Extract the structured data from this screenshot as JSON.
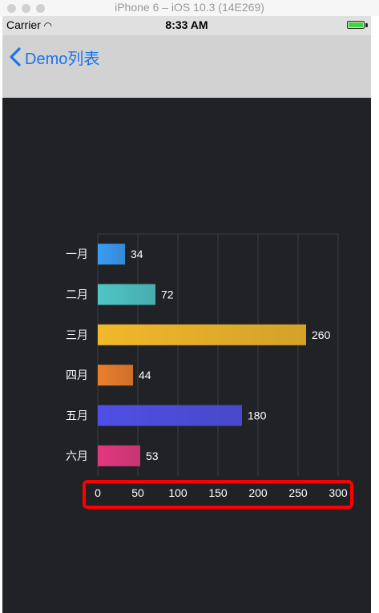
{
  "window": {
    "title": "iPhone 6 – iOS 10.3 (14E269)"
  },
  "status_bar": {
    "carrier": "Carrier",
    "time": "8:33 AM",
    "wifi_icon": "wifi-icon",
    "battery_icon": "battery-icon"
  },
  "nav_bar": {
    "back_label": "Demo列表",
    "back_icon": "chevron-left-icon"
  },
  "colors": {
    "screen_bg": "#202225",
    "nav_tint": "#1a74f0",
    "axis_text": "#ffffff",
    "grid": "#3a3d42",
    "highlight": "#ff0000"
  },
  "chart_data": {
    "type": "bar",
    "orientation": "horizontal",
    "categories": [
      "一月",
      "二月",
      "三月",
      "四月",
      "五月",
      "六月"
    ],
    "values": [
      34,
      72,
      260,
      44,
      180,
      53
    ],
    "bar_colors": [
      "#3a9cf5",
      "#4fc5c5",
      "#f2b82a",
      "#ec7e2c",
      "#4f4fe6",
      "#e3387e"
    ],
    "xlim": [
      0,
      300
    ],
    "xticks": [
      0,
      50,
      100,
      150,
      200,
      250,
      300
    ],
    "grid": true,
    "data_labels": true,
    "title": "",
    "xlabel": "",
    "ylabel": ""
  }
}
